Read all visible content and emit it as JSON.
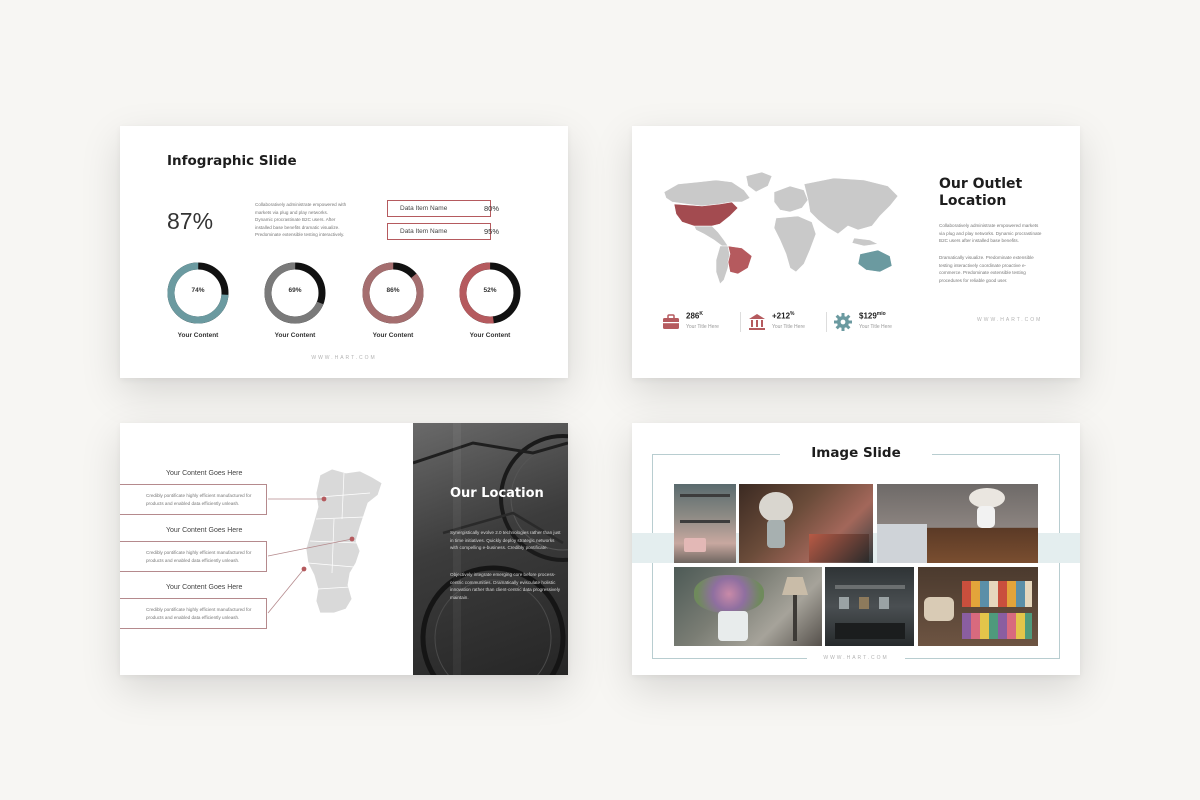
{
  "footer_url": "WWW.HART.COM",
  "colors": {
    "teal": "#6b9aa0",
    "red": "#b55a5e",
    "gray": "#7a7a7a",
    "rose": "#a56e6f",
    "black": "#111111"
  },
  "slide1": {
    "title": "Infographic Slide",
    "big_percent": "87%",
    "description": "Collaboratively administrate empowered with markets via plug and play networks. Dynamic procrastinate B2C users. After installed base benefits dramatic visualize. Predominate extensible testing interactively.",
    "items": [
      {
        "label": "Data Item Name",
        "percent": "80%"
      },
      {
        "label": "Data Item Name",
        "percent": "95%"
      }
    ],
    "donuts": [
      {
        "label": "74%",
        "value": 74,
        "caption": "Your Content",
        "color": "#6b9aa0"
      },
      {
        "label": "69%",
        "value": 69,
        "caption": "Your Content",
        "color": "#7a7a7a"
      },
      {
        "label": "86%",
        "value": 86,
        "caption": "Your Content",
        "color": "#a56e6f"
      },
      {
        "label": "52%",
        "value": 52,
        "caption": "Your Content",
        "color": "#b55a5e"
      }
    ]
  },
  "slide2": {
    "title": "Our Outlet Location",
    "paragraph1": "Collaboratively administrate empowered markets via plug and play networks. Dynamic procrastinate B2C users after installed base benefits.",
    "paragraph2": "Dramatically visualize. Predominate extensible testing interactively coordinate proactive e-commerce. Predominate extensible testing procedures for reliable good user.",
    "stats": [
      {
        "icon": "briefcase-icon",
        "value": "286",
        "sup": "K",
        "caption": "Your Title Here"
      },
      {
        "icon": "bank-icon",
        "value": "+212",
        "sup": "%",
        "caption": "Your Title Here"
      },
      {
        "icon": "gear-icon",
        "value": "$129",
        "sup": "mio",
        "caption": "Your Title Here"
      }
    ]
  },
  "slide3": {
    "items": [
      {
        "heading": "Your Content Goes Here",
        "text": "Credibly pontificate highly efficient manufactured for products and enabled data efficiently unleash."
      },
      {
        "heading": "Your Content Goes Here",
        "text": "Credibly pontificate highly efficient manufactured for products and enabled data efficiently unleash."
      },
      {
        "heading": "Your Content Goes Here",
        "text": "Credibly pontificate highly efficient manufactured for products and enabled data efficiently unleash."
      }
    ],
    "location_title": "Our Location",
    "paragraph1": "Synergistically evolve 2.0 technologies rather than just in time initiatives. Quickly deploy strategic networks with compelling e-business. Credibly pontificate.",
    "paragraph2": "Objectively integrate emerging core before process-centric communities. Dramatically evisculate holistic innovation rather than client-centric data progressively maintain."
  },
  "slide4": {
    "title": "Image Slide"
  }
}
